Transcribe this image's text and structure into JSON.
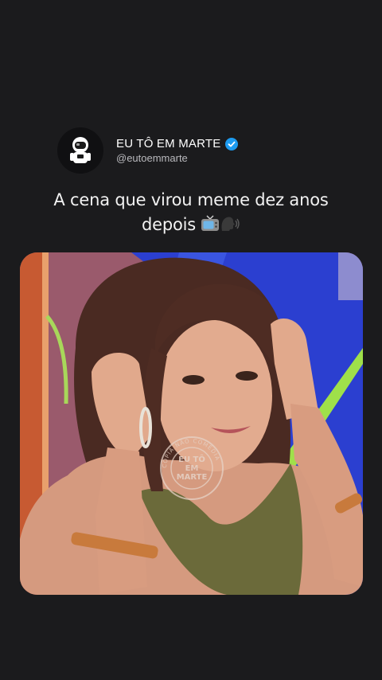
{
  "post": {
    "display_name": "EU TÔ EM MARTE",
    "handle": "@eutoemmarte",
    "verified": true,
    "caption_line1": "A cena que virou meme dez anos",
    "caption_line2": "depois",
    "caption_emojis": [
      "tv-icon",
      "speaking-head-icon"
    ]
  },
  "watermark": {
    "line1": "EU TÔ",
    "line2": "EM",
    "line3": "MARTE",
    "ring_text": "COPIA NÃO COMÉDIA"
  },
  "colors": {
    "background": "#1b1b1d",
    "verified_blue": "#1d9bf0",
    "handle_gray": "#b9b9bd"
  }
}
